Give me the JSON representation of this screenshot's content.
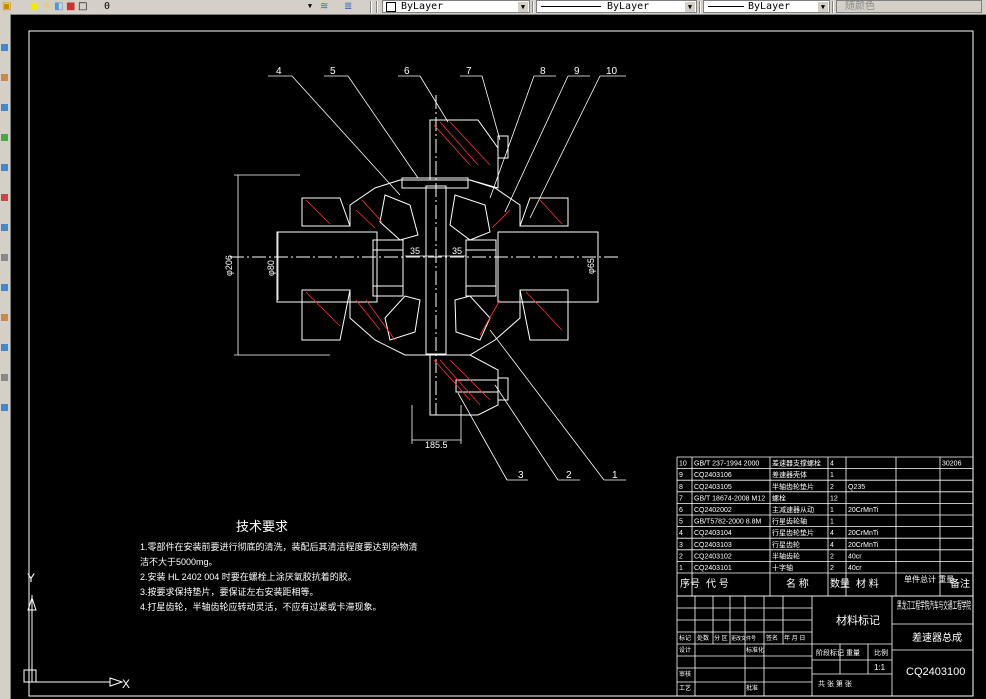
{
  "toolbar": {
    "layer_name": "0",
    "color_combo": "ByLayer",
    "linetype_combo": "ByLayer",
    "lineweight_combo": "ByLayer",
    "plotstyle_combo": "随颜色"
  },
  "drawing": {
    "balloons": [
      "4",
      "5",
      "6",
      "7",
      "8",
      "9",
      "10",
      "3",
      "2",
      "1"
    ],
    "dims": {
      "d1": "φ206",
      "d2": "φ80",
      "d3": "φ65",
      "w1": "35",
      "w2": "35",
      "bottom": "185.5"
    },
    "notes_title": "技术要求",
    "notes": [
      "1.零部件在安装前要进行彻底的清洗，装配后其清洁程度要达到杂物清",
      "  洁不大于5000mg。",
      "2.安装 HL 2402 004 时要在螺栓上涂厌氧胶抗着的胶。",
      "3.按要求保持垫片，要保证左右安装距相等。",
      "4.打星齿轮，半轴齿轮应转动灵活，不应有过紧或卡滞现象。"
    ]
  },
  "bom": {
    "rows": [
      {
        "no": "10",
        "code": "GB/T 237-1994 2000",
        "name": "差速器支撑螺栓",
        "qty": "4",
        "mat": "",
        "note": "30206"
      },
      {
        "no": "9",
        "code": "CQ2403106",
        "name": "差速器壳体",
        "qty": "1",
        "mat": "",
        "note": ""
      },
      {
        "no": "8",
        "code": "CQ2403105",
        "name": "半轴齿轮垫片",
        "qty": "2",
        "mat": "Q235",
        "note": ""
      },
      {
        "no": "7",
        "code": "GB/T 18674-2008 M12",
        "name": "螺栓",
        "qty": "12",
        "mat": "",
        "note": ""
      },
      {
        "no": "6",
        "code": "CQ2402002",
        "name": "主减速器从动",
        "qty": "1",
        "mat": "20CrMnTi",
        "note": ""
      },
      {
        "no": "5",
        "code": "GB/T5782-2000 8.8M",
        "name": "行星齿轮轴",
        "qty": "1",
        "mat": "",
        "note": ""
      },
      {
        "no": "4",
        "code": "CQ2403104",
        "name": "行星齿轮垫片",
        "qty": "4",
        "mat": "20CrMnTi",
        "note": ""
      },
      {
        "no": "3",
        "code": "CQ2403103",
        "name": "行星齿轮",
        "qty": "4",
        "mat": "20CrMnTi",
        "note": ""
      },
      {
        "no": "2",
        "code": "CQ2403102",
        "name": "半轴齿轮",
        "qty": "2",
        "mat": "40cr",
        "note": ""
      },
      {
        "no": "1",
        "code": "CQ2403101",
        "name": "十字轴",
        "qty": "2",
        "mat": "40cr",
        "note": ""
      }
    ],
    "header": {
      "no": "序号",
      "code": "代 号",
      "name": "名 称",
      "qty": "数量",
      "mat": "材 料",
      "weight": "单件总计 重量",
      "note": "备注"
    }
  },
  "titleblock": {
    "material_mark": "材料标记",
    "school": "黑龙江工程学院汽车与交通工程学院",
    "title": "差速器总成",
    "drawing_no": "CQ2403100",
    "scale": "1:1",
    "stage_mark": "阶段标记",
    "weight": "重量",
    "ratio": "比例",
    "sheet": "共 张 第 张",
    "row_labels": [
      "标记",
      "处数",
      "分 区",
      "更改文件号",
      "签名",
      "年 月 日"
    ],
    "side_labels": [
      "设计",
      "标准化",
      "审核",
      "工艺",
      "批准"
    ]
  },
  "colors": {
    "bg": "#000000",
    "line": "#ffffff",
    "cut": "#ff3030",
    "text": "#ffffff"
  }
}
